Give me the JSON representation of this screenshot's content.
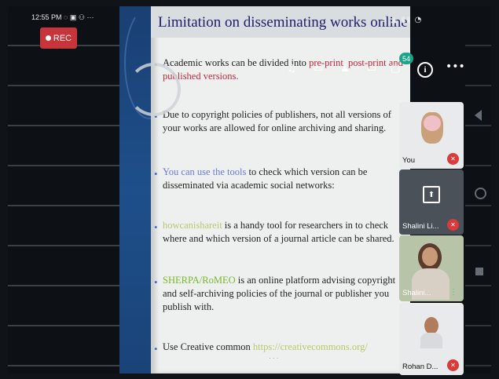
{
  "status_bar": {
    "time": "12:55 PM",
    "right_icons": "⌂ ▲ ▮▮ ◔",
    "rec_label": "REC"
  },
  "slide": {
    "title": "Limitation on disseminating works online",
    "bullets": [
      {
        "prefix": "Academic works can be divided into ",
        "colored": "pre-print, post-print and published versions.",
        "suffix": ""
      },
      {
        "prefix": "Due to copyright policies of publishers, not all versions of your works are allowed for online archiving and sharing.",
        "colored": "",
        "suffix": ""
      },
      {
        "prefix": "",
        "colored": "You can use the tools",
        "suffix": " to check which version can be disseminated via academic social networks:"
      },
      {
        "prefix": "",
        "colored": "howcanishareit",
        "suffix": " is a handy tool for researchers in to check where and which version of a journal article can be shared."
      },
      {
        "prefix": "",
        "colored": "SHERPA/RoMEO",
        "suffix": " is an online platform advising copyright and self-archiving policies of the journal or publisher you publish with."
      },
      {
        "prefix": "Use Creative common ",
        "colored": "https://creativecommons.org/",
        "suffix": ""
      }
    ]
  },
  "toolbar": {
    "chat_badge_count": "54",
    "info_icon": "info-icon",
    "more_icon": "more-icon"
  },
  "participants": [
    {
      "name": "You",
      "muted": true
    },
    {
      "name": "Shalini Li...",
      "muted": true
    },
    {
      "name": "Shalini...",
      "muted": false
    },
    {
      "name": "Rohan D...",
      "muted": true
    }
  ],
  "colors": {
    "rec": "#c8343b",
    "mute": "#d93a3a",
    "slide_title": "#1c1f6a",
    "badge": "#1ca48a"
  }
}
